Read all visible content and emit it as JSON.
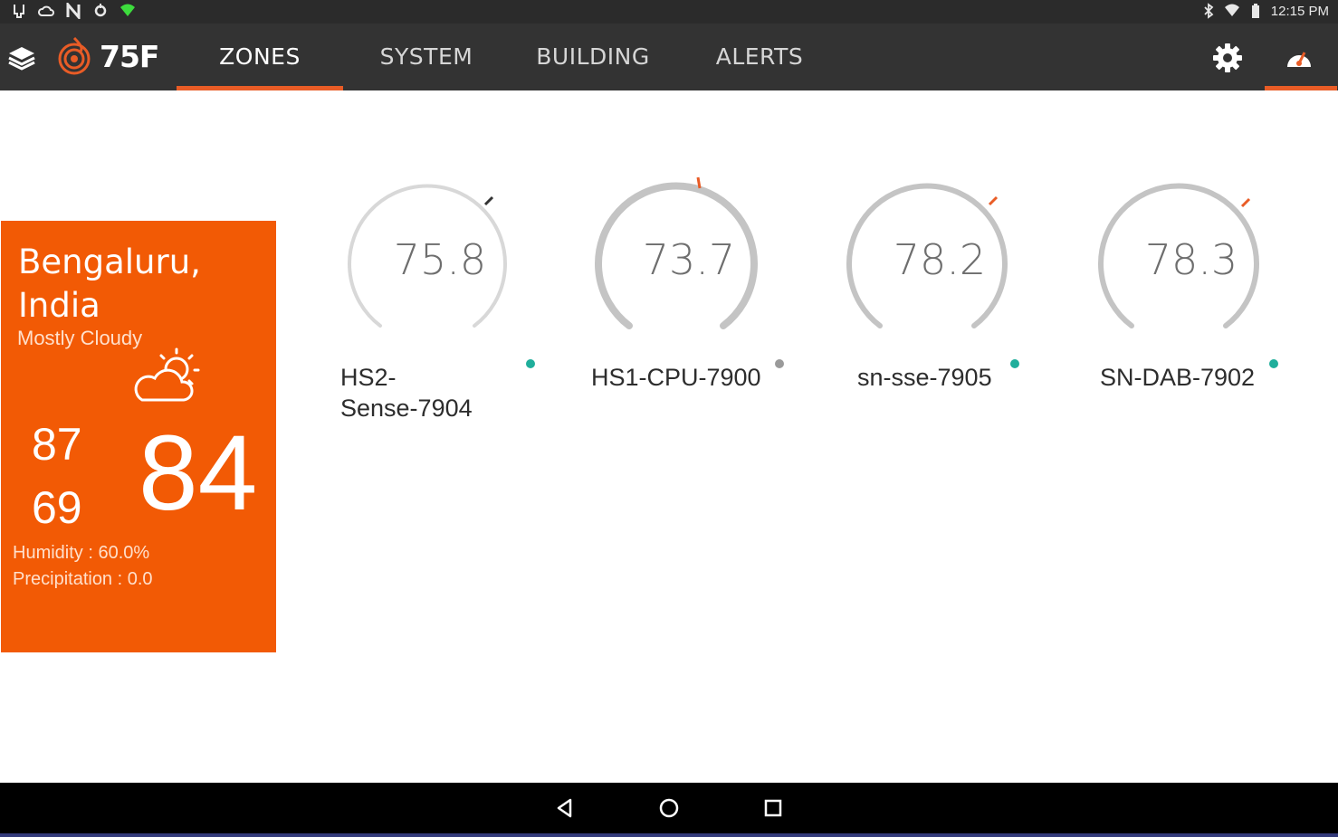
{
  "status_bar": {
    "time": "12:15 PM"
  },
  "nav": {
    "logo_text": "75F",
    "tabs": [
      {
        "label": "ZONES",
        "active": true
      },
      {
        "label": "SYSTEM",
        "active": false
      },
      {
        "label": "BUILDING",
        "active": false
      },
      {
        "label": "ALERTS",
        "active": false
      }
    ],
    "accent_color": "#e95c26",
    "icons": [
      "layers-icon",
      "gear-icon",
      "gauge-icon"
    ]
  },
  "weather": {
    "city": "Bengaluru, India",
    "condition": "Mostly Cloudy",
    "icon": "partly-cloudy-icon",
    "high": "87",
    "low": "69",
    "current": "84",
    "humidity": "Humidity : 60.0%",
    "precipitation": "Precipitation : 0.0",
    "card_color": "#f25a05"
  },
  "zones": [
    {
      "name_line1": "HS2-",
      "name_line2": "Sense-7904",
      "temp": "75.8",
      "status_color": "#1fae9b",
      "arc": "light"
    },
    {
      "name_line1": "HS1-CPU-7900",
      "name_line2": "",
      "temp": "73.7",
      "status_color": "#9a9a9a",
      "arc": "heavy"
    },
    {
      "name_line1": "sn-sse-7905",
      "name_line2": "",
      "temp": "78.2",
      "status_color": "#1fae9b",
      "arc": "heavy"
    },
    {
      "name_line1": "SN-DAB-7902",
      "name_line2": "",
      "temp": "78.3",
      "status_color": "#1fae9b",
      "arc": "heavy"
    }
  ]
}
